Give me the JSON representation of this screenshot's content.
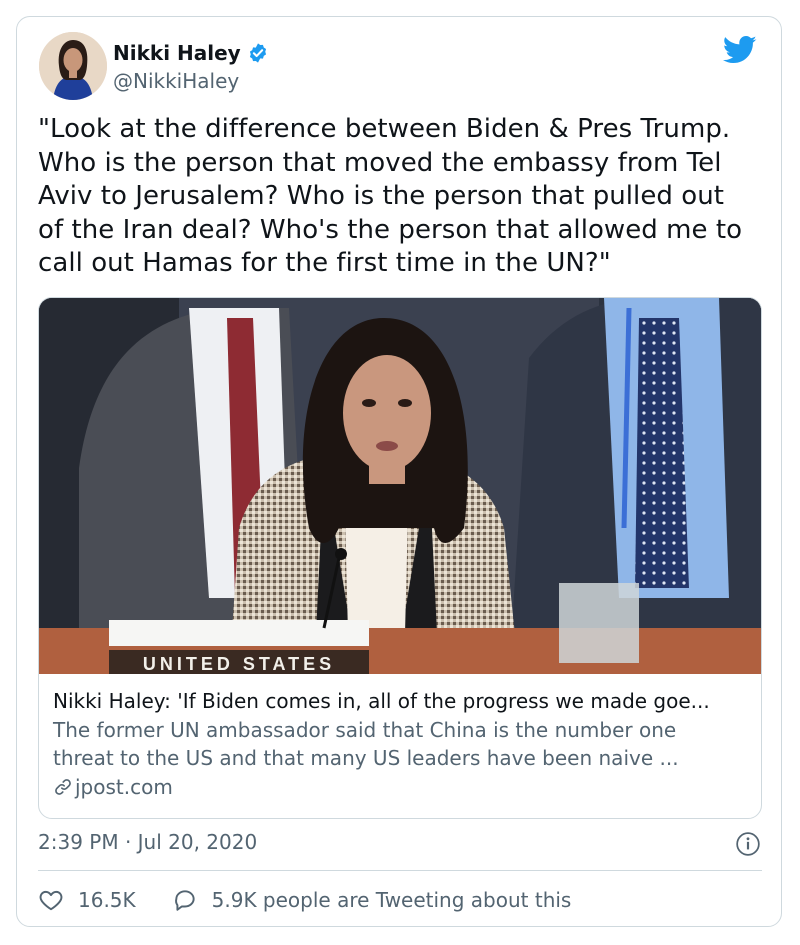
{
  "author": {
    "name": "Nikki Haley",
    "handle": "@NikkiHaley",
    "verified_icon": "verified-badge-icon"
  },
  "brand": {
    "icon": "twitter-bird-icon",
    "color": "#1d9bf0"
  },
  "tweet": {
    "text": "\"Look at the difference between Biden & Pres Trump.\nWho is the person that moved the embassy from Tel\nAviv to Jerusalem? Who is the person that pulled out\nof the Iran deal? Who's the person that allowed me to\ncall out Hamas for the first time in the UN?\""
  },
  "link_card": {
    "image_sign_text": "UNITED STATES",
    "title": "Nikki Haley: 'If Biden comes in, all of the progress we made goe...",
    "description": "The former UN ambassador said that China is the number one\nthreat to the US and that many US leaders have been naive ...",
    "domain": "jpost.com",
    "domain_icon": "link-icon"
  },
  "meta": {
    "timestamp": "2:39 PM · Jul 20, 2020",
    "info_icon": "info-icon"
  },
  "footer": {
    "like_count": "16.5K",
    "reply_text": "5.9K people are Tweeting about this"
  },
  "colors": {
    "text_primary": "#0f1419",
    "text_secondary": "#536471",
    "border": "#cfd9de",
    "accent": "#1d9bf0"
  }
}
